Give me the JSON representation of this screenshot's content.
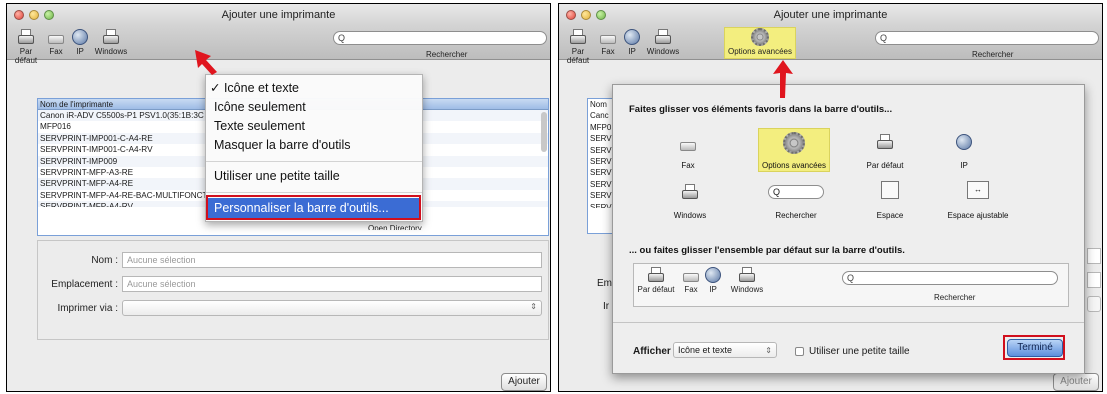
{
  "left": {
    "window_title": "Ajouter une imprimante",
    "toolbar": {
      "default_label": "Par défaut",
      "fax_label": "Fax",
      "ip_label": "IP",
      "windows_label": "Windows",
      "search_placeholder": "Q",
      "search_caption": "Rechercher"
    },
    "list": {
      "header": "Nom de l'imprimante",
      "rows": [
        "Canon iR-ADV C5500s-P1 PSV1.0(35:1B:3C",
        "MFP016",
        "SERVPRINT-IMP001-C-A4-RE",
        "SERVPRINT-IMP001-C-A4-RV",
        "SERVPRINT-IMP009",
        "SERVPRINT-MFP-A3-RE",
        "SERVPRINT-MFP-A4-RE",
        "SERVPRINT-MFP-A4-RE-BAC-MULTIFONCT",
        "SERVPRINT-MFP-A4-RV"
      ],
      "partial_right_text": "Open Directory"
    },
    "form": {
      "name_label": "Nom :",
      "name_value": "Aucune sélection",
      "location_label": "Emplacement :",
      "location_value": "Aucune sélection",
      "print_via_label": "Imprimer via :"
    },
    "add_button": "Ajouter",
    "context_menu": {
      "items": [
        "✓ Icône et texte",
        "Icône seulement",
        "Texte seulement",
        "Masquer la barre d'outils",
        "Utiliser une petite taille"
      ],
      "highlighted": "Personnaliser la barre d'outils..."
    }
  },
  "right": {
    "window_title": "Ajouter une imprimante",
    "toolbar": {
      "default_label": "Par défaut",
      "fax_label": "Fax",
      "ip_label": "IP",
      "windows_label": "Windows",
      "advanced_label": "Options avancées",
      "search_placeholder": "Q",
      "search_caption": "Rechercher"
    },
    "sheet": {
      "heading_top": "Faites glisser vos éléments favoris dans la barre d'outils...",
      "items": {
        "fax": "Fax",
        "advanced": "Options avancées",
        "default": "Par défaut",
        "ip": "IP",
        "windows": "Windows",
        "search": "Rechercher",
        "space": "Espace",
        "flexible_space": "Espace ajustable"
      },
      "search_placeholder": "Q",
      "heading_bottom": "... ou faites glisser l'ensemble par défaut sur la barre d'outils.",
      "default_set": {
        "default": "Par défaut",
        "fax": "Fax",
        "ip": "IP",
        "windows": "Windows",
        "search_placeholder": "Q",
        "search": "Rechercher"
      },
      "show_label": "Afficher",
      "show_value": "Icône et texte",
      "small_size_label": "Utiliser une petite taille",
      "done_button": "Terminé"
    },
    "background_fragments": {
      "list_prefix": [
        "Nom",
        "Canc",
        "MFP0",
        "SERV",
        "SERV",
        "SERV",
        "SERV",
        "SERV",
        "SERV",
        "SERV"
      ],
      "form_prefix_1": "Em",
      "form_prefix_2": "Ir",
      "add_button": "Ajouter"
    }
  },
  "colors": {
    "highlight_blue": "#3b6cd4",
    "annotation_red": "#d10f1d",
    "highlight_yellow": "#f3ee7f"
  }
}
